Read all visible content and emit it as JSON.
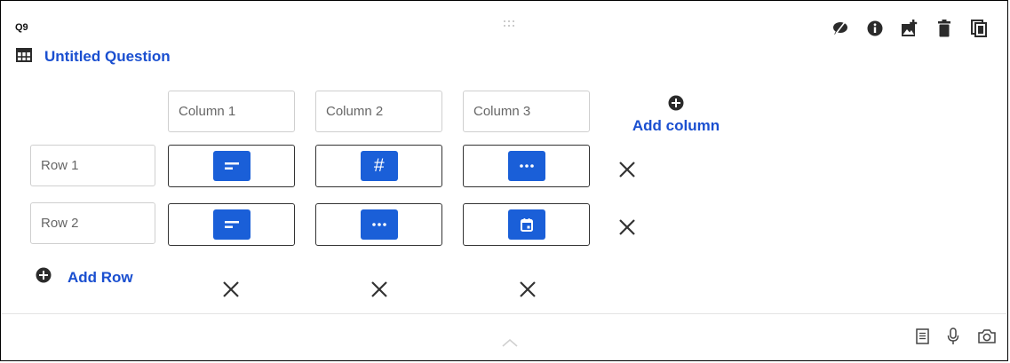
{
  "question": {
    "number": "Q9",
    "title": "Untitled Question",
    "type_icon": "grid-table-icon"
  },
  "toolbar": {
    "icons": [
      "hide-eye-icon",
      "info-icon",
      "add-image-icon",
      "delete-trash-icon",
      "duplicate-copy-icon"
    ]
  },
  "matrix": {
    "columns": [
      {
        "placeholder": "Column 1"
      },
      {
        "placeholder": "Column 2"
      },
      {
        "placeholder": "Column 3"
      }
    ],
    "rows": [
      {
        "placeholder": "Row 1",
        "cell_types": [
          "text-icon",
          "number-hash-icon",
          "dots-more-icon"
        ]
      },
      {
        "placeholder": "Row 2",
        "cell_types": [
          "text-icon",
          "dots-more-icon",
          "calendar-date-icon"
        ]
      }
    ],
    "add_column_label": "Add column",
    "add_row_label": "Add Row",
    "number_symbol": "#"
  },
  "footer": {
    "icons": [
      "notes-document-icon",
      "microphone-icon",
      "camera-icon"
    ]
  },
  "colors": {
    "accent": "#1a5fd8",
    "link": "#1a4fd0",
    "icon_dark": "#2b2b2b"
  }
}
